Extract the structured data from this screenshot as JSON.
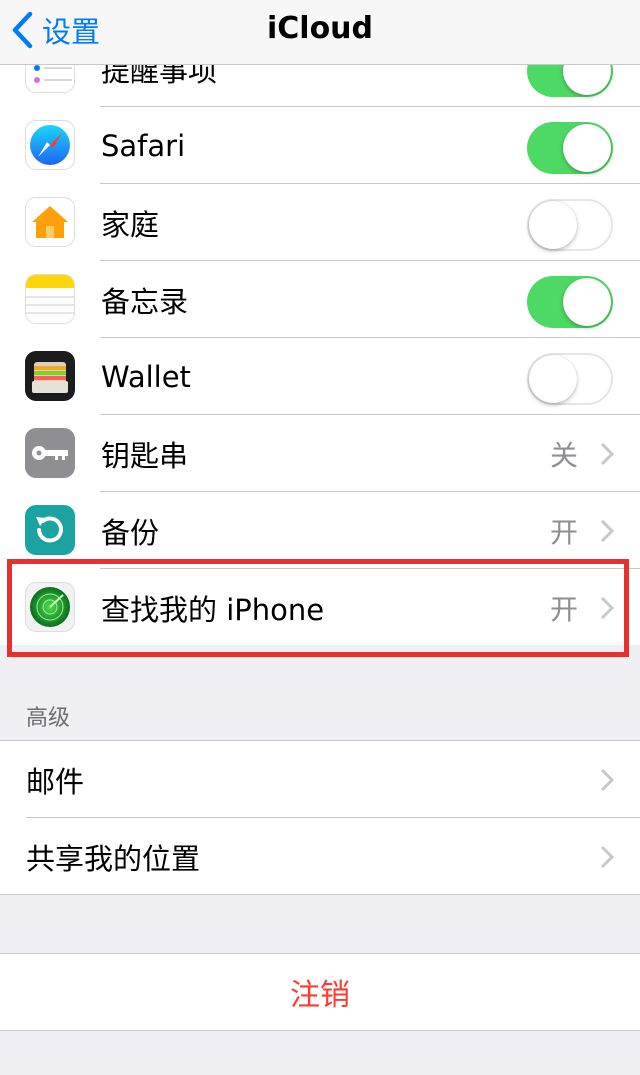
{
  "nav": {
    "back_label": "设置",
    "title": "iCloud"
  },
  "apps": [
    {
      "label": "提醒事项",
      "control": "toggle",
      "on": true,
      "icon": "reminders-icon"
    },
    {
      "label": "Safari",
      "control": "toggle",
      "on": true,
      "icon": "safari-icon"
    },
    {
      "label": "家庭",
      "control": "toggle",
      "on": false,
      "icon": "home-icon"
    },
    {
      "label": "备忘录",
      "control": "toggle",
      "on": true,
      "icon": "notes-icon"
    },
    {
      "label": "Wallet",
      "control": "toggle",
      "on": false,
      "icon": "wallet-icon"
    },
    {
      "label": "钥匙串",
      "control": "disclosure",
      "value": "关",
      "icon": "keychain-icon"
    },
    {
      "label": "备份",
      "control": "disclosure",
      "value": "开",
      "icon": "backup-icon"
    },
    {
      "label": "查找我的 iPhone",
      "control": "disclosure",
      "value": "开",
      "icon": "find-my-iphone-icon"
    }
  ],
  "advanced": {
    "header": "高级",
    "items": [
      {
        "label": "邮件"
      },
      {
        "label": "共享我的位置"
      }
    ]
  },
  "logout_label": "注销",
  "colors": {
    "accent": "#007aff",
    "toggle_on": "#4cd964",
    "destructive": "#ff3b30",
    "highlight": "#e8312c"
  }
}
